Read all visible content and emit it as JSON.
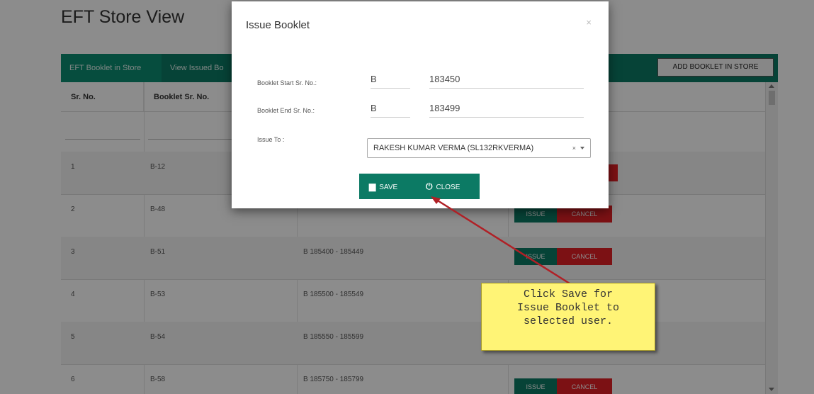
{
  "page": {
    "title": "EFT Store View",
    "tabs": [
      {
        "label": "EFT Booklet in Store"
      },
      {
        "label": "View Issued Bo"
      }
    ],
    "add_button": "ADD BOOKLET IN STORE"
  },
  "table": {
    "headers": [
      "Sr. No.",
      "Booklet Sr. No."
    ],
    "rows": [
      {
        "sr": "1",
        "booklet": "B-12",
        "range": ""
      },
      {
        "sr": "2",
        "booklet": "B-48",
        "range": ""
      },
      {
        "sr": "3",
        "booklet": "B-51",
        "range": "B 185400 - 185449"
      },
      {
        "sr": "4",
        "booklet": "B-53",
        "range": "B 185500 - 185549"
      },
      {
        "sr": "5",
        "booklet": "B-54",
        "range": "B 185550 - 185599"
      },
      {
        "sr": "6",
        "booklet": "B-58",
        "range": "B 185750 - 185799"
      }
    ],
    "issue_label": "ISSUE",
    "cancel_label": "CANCEL"
  },
  "modal": {
    "title": "Issue Booklet",
    "close_symbol": "×",
    "start_label": "Booklet Start Sr. No.:",
    "start_prefix": "B",
    "start_value": "183450",
    "end_label": "Booklet End Sr. No.:",
    "end_prefix": "B",
    "end_value": "183499",
    "issue_to_label": "Issue To :",
    "issue_to_value": "RAKESH KUMAR VERMA (SL132RKVERMA)",
    "clear_symbol": "×",
    "save_label": "SAVE",
    "close_label": "CLOSE"
  },
  "callout": {
    "text": "Click Save for Issue Booklet to selected user.",
    "lines": [
      "Click Save for",
      "Issue Booklet to",
      "selected user."
    ]
  },
  "colors": {
    "primary": "#0c7a64",
    "danger": "#e21f26",
    "callout_bg": "#fff476",
    "arrow": "#b02026"
  }
}
